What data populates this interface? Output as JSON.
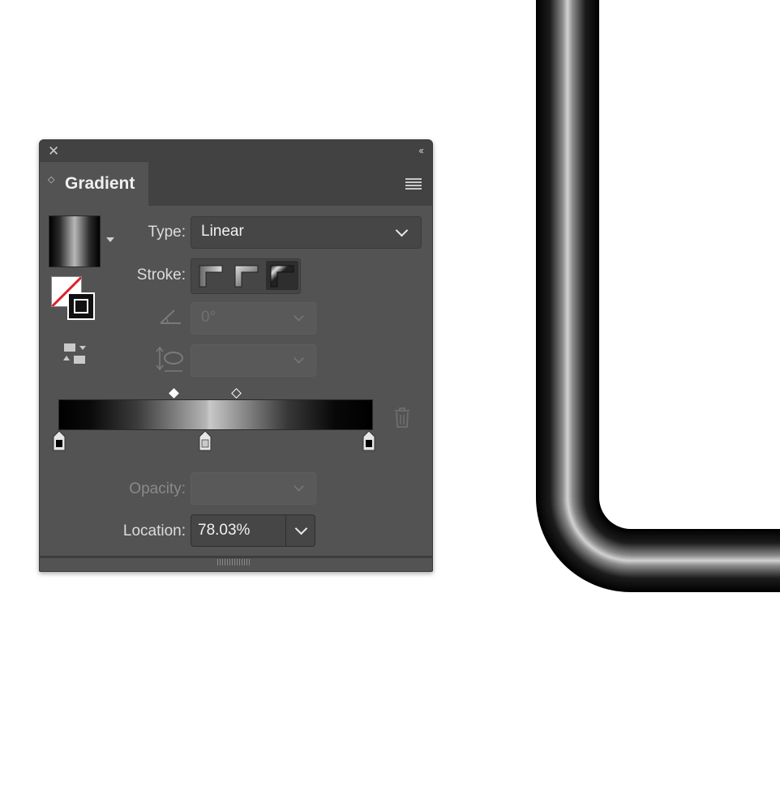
{
  "panel": {
    "title": "Gradient",
    "close_glyph": "✕",
    "collapse_glyph": "‹‹",
    "menu_icon": "hamburger-menu-icon"
  },
  "type": {
    "label": "Type:",
    "value": "Linear"
  },
  "stroke": {
    "label": "Stroke:",
    "options": [
      "apply-within-stroke",
      "apply-along-stroke",
      "apply-across-stroke"
    ],
    "selected": "apply-across-stroke"
  },
  "angle": {
    "icon": "angle-icon",
    "value": "0°",
    "enabled": false
  },
  "aspect_ratio": {
    "icon": "aspect-ratio-icon",
    "value": "",
    "enabled": false
  },
  "gradient": {
    "stops": [
      {
        "location": 0,
        "color": "#000000"
      },
      {
        "location": 50,
        "color": "#c9c9c9"
      },
      {
        "location": 100,
        "color": "#000000"
      }
    ],
    "selected_stop": 2,
    "midpoints": [
      {
        "location": 37,
        "selected": true
      },
      {
        "location": 57,
        "selected": false
      }
    ]
  },
  "opacity": {
    "label": "Opacity:",
    "value": "",
    "enabled": false
  },
  "location": {
    "label": "Location:",
    "value": "78.03%"
  },
  "colors": {
    "panel_bg": "#535353",
    "header_bg": "#424242",
    "field_bg": "#464646",
    "none_slash": "#e0202a"
  }
}
